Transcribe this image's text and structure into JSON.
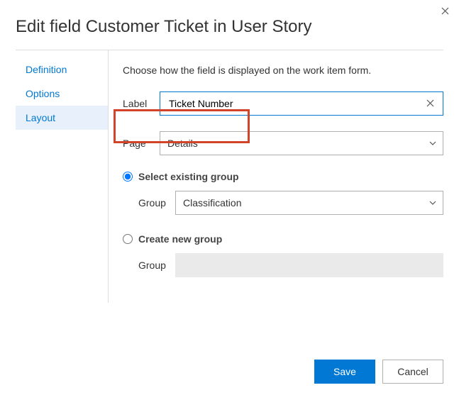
{
  "dialog": {
    "title": "Edit field Customer Ticket in User Story",
    "close_label": "Close"
  },
  "sidebar": {
    "items": [
      {
        "label": "Definition",
        "selected": false
      },
      {
        "label": "Options",
        "selected": false
      },
      {
        "label": "Layout",
        "selected": true
      }
    ]
  },
  "main": {
    "description": "Choose how the field is displayed on the work item form.",
    "label_field": {
      "label": "Label",
      "value": "Ticket Number"
    },
    "page_field": {
      "label": "Page",
      "value": "Details"
    },
    "group_radio": {
      "existing": {
        "label": "Select existing group",
        "checked": true
      },
      "new": {
        "label": "Create new group",
        "checked": false
      }
    },
    "group_existing": {
      "label": "Group",
      "value": "Classification"
    },
    "group_new": {
      "label": "Group",
      "value": ""
    }
  },
  "footer": {
    "save": "Save",
    "cancel": "Cancel"
  }
}
